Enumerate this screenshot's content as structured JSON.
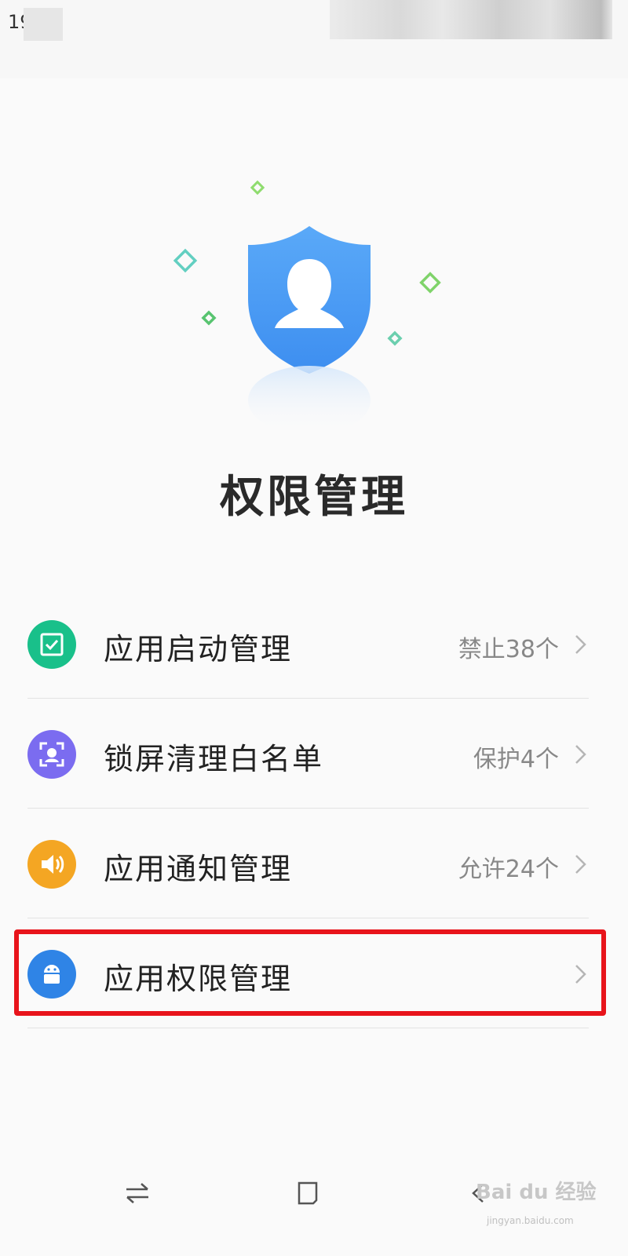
{
  "status_bar": {
    "time_partial": "19"
  },
  "page": {
    "title": "权限管理"
  },
  "list": {
    "items": [
      {
        "label": "应用启动管理",
        "status": "禁止38个",
        "icon": "checkbox-icon",
        "color": "#19c08a"
      },
      {
        "label": "锁屏清理白名单",
        "status": "保护4个",
        "icon": "face-scan-icon",
        "color": "#7b6cf0"
      },
      {
        "label": "应用通知管理",
        "status": "允许24个",
        "icon": "speaker-icon",
        "color": "#f4a623"
      },
      {
        "label": "应用权限管理",
        "status": "",
        "icon": "android-icon",
        "color": "#2f84e6"
      }
    ]
  },
  "highlight": {
    "color": "#e8141b",
    "target": "应用权限管理"
  },
  "watermark": {
    "text": "Bai du 经验",
    "url": "jingyan.baidu.com"
  },
  "colors": {
    "shield": "#4f9df5",
    "accent_green": "#7fd36a",
    "accent_teal": "#5fcfc0"
  }
}
